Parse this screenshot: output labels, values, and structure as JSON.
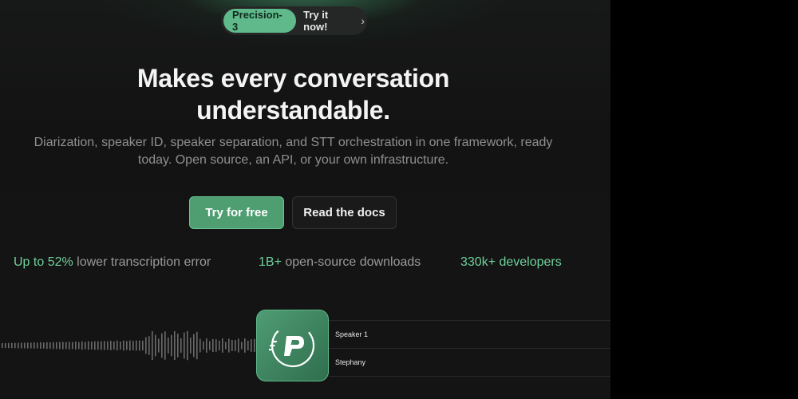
{
  "announcement": {
    "badge": "Precision-3",
    "link_text": "Try it now!",
    "chevron": "›"
  },
  "hero": {
    "headline_line1": "Makes every conversation",
    "headline_line2": "understandable.",
    "subhead_line1": "Diarization, speaker ID, speaker separation, and STT orchestration in one framework, ready",
    "subhead_line2": "today. Open source, an API, or your own infrastructure."
  },
  "cta": {
    "primary_label": "Try for free",
    "secondary_label": "Read the docs"
  },
  "stats": [
    {
      "highlight": "Up to 52%",
      "text": " lower transcription error"
    },
    {
      "highlight": "1B+",
      "text": " open-source downloads"
    },
    {
      "highlight": "330k+ developers",
      "text": ""
    }
  ],
  "speakers": [
    "Speaker 1",
    "Stephany"
  ],
  "icons": {
    "logo": "pyannote-logo-icon",
    "waveform": "audio-waveform"
  },
  "colors": {
    "accent": "#5fb98a",
    "primary_button": "#4e9e72",
    "background": "#141414"
  }
}
